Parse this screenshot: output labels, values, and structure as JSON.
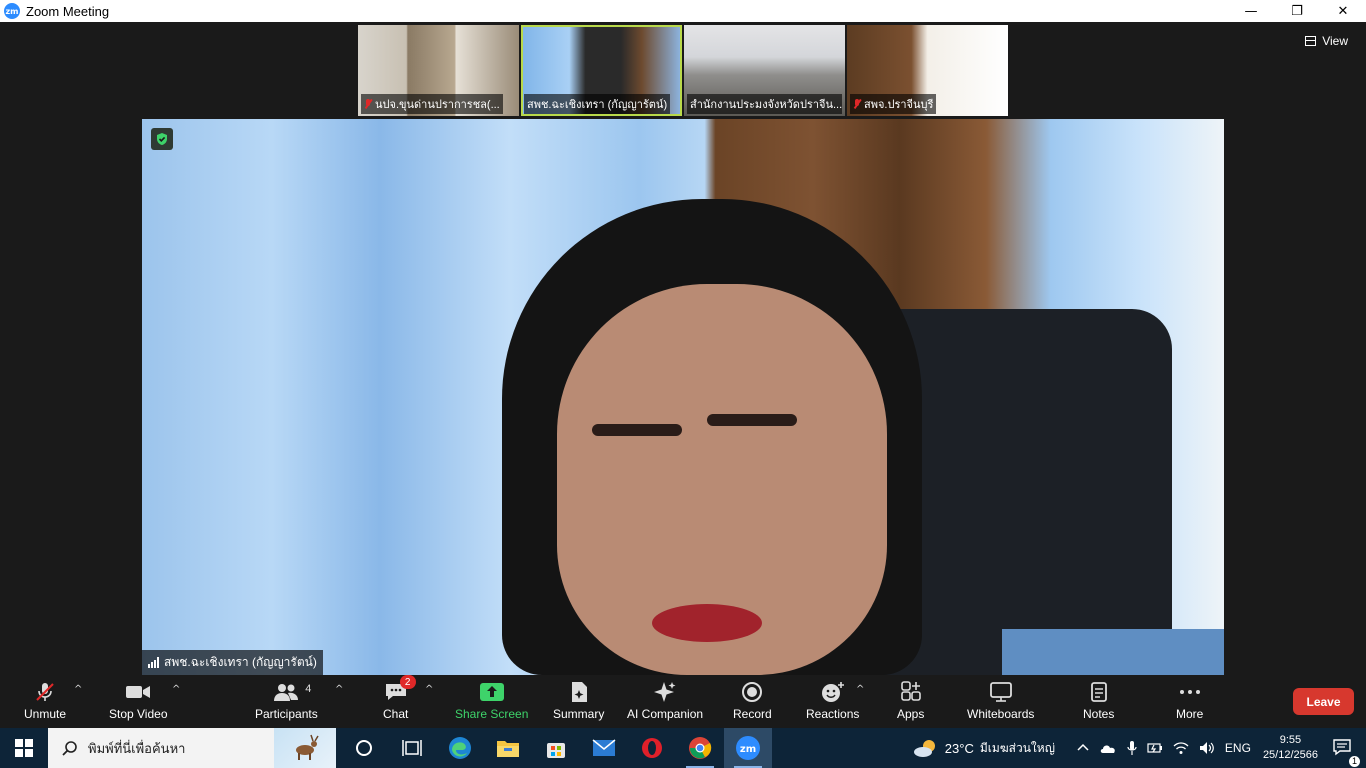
{
  "window": {
    "logo_text": "zm",
    "title": "Zoom Meeting",
    "controls": {
      "minimize": "—",
      "restore": "❐",
      "close": "✕"
    }
  },
  "meeting": {
    "view_label": "View",
    "thumbnails": [
      {
        "name": "นปจ.ขุนด่านปราการชล(...",
        "muted": true
      },
      {
        "name": "สพช.ฉะเชิงเทรา (กัญญารัตน์)",
        "muted": false,
        "active": true
      },
      {
        "name": "สำนักงานประมงจังหวัดปราจีน...",
        "muted": false
      },
      {
        "name": "สพจ.ปราจีนบุรี",
        "muted": true
      }
    ],
    "speaker_name": "สพช.ฉะเชิงเทรา (กัญญารัตน์)"
  },
  "toolbar": {
    "unmute": "Unmute",
    "stop_video": "Stop Video",
    "participants": "Participants",
    "participants_count": "4",
    "chat": "Chat",
    "chat_badge": "2",
    "share_screen": "Share Screen",
    "summary": "Summary",
    "ai_companion": "AI Companion",
    "record": "Record",
    "reactions": "Reactions",
    "apps": "Apps",
    "whiteboards": "Whiteboards",
    "notes": "Notes",
    "more": "More",
    "leave": "Leave",
    "colors": {
      "share_green": "#3ed36a",
      "leave_red": "#d7382e",
      "mute_red": "#e02828"
    }
  },
  "taskbar": {
    "search_placeholder": "พิมพ์ที่นี่เพื่อค้นหา",
    "temperature": "23°C",
    "weather_text": "มีเมฆส่วนใหญ่",
    "language": "ENG",
    "time": "9:55",
    "date": "25/12/2566",
    "notification_count": "1",
    "apps": [
      "cortana-icon",
      "task-view-icon",
      "edge-icon",
      "file-explorer-icon",
      "microsoft-store-icon",
      "mail-icon",
      "opera-icon",
      "chrome-icon",
      "zoom-icon"
    ]
  }
}
